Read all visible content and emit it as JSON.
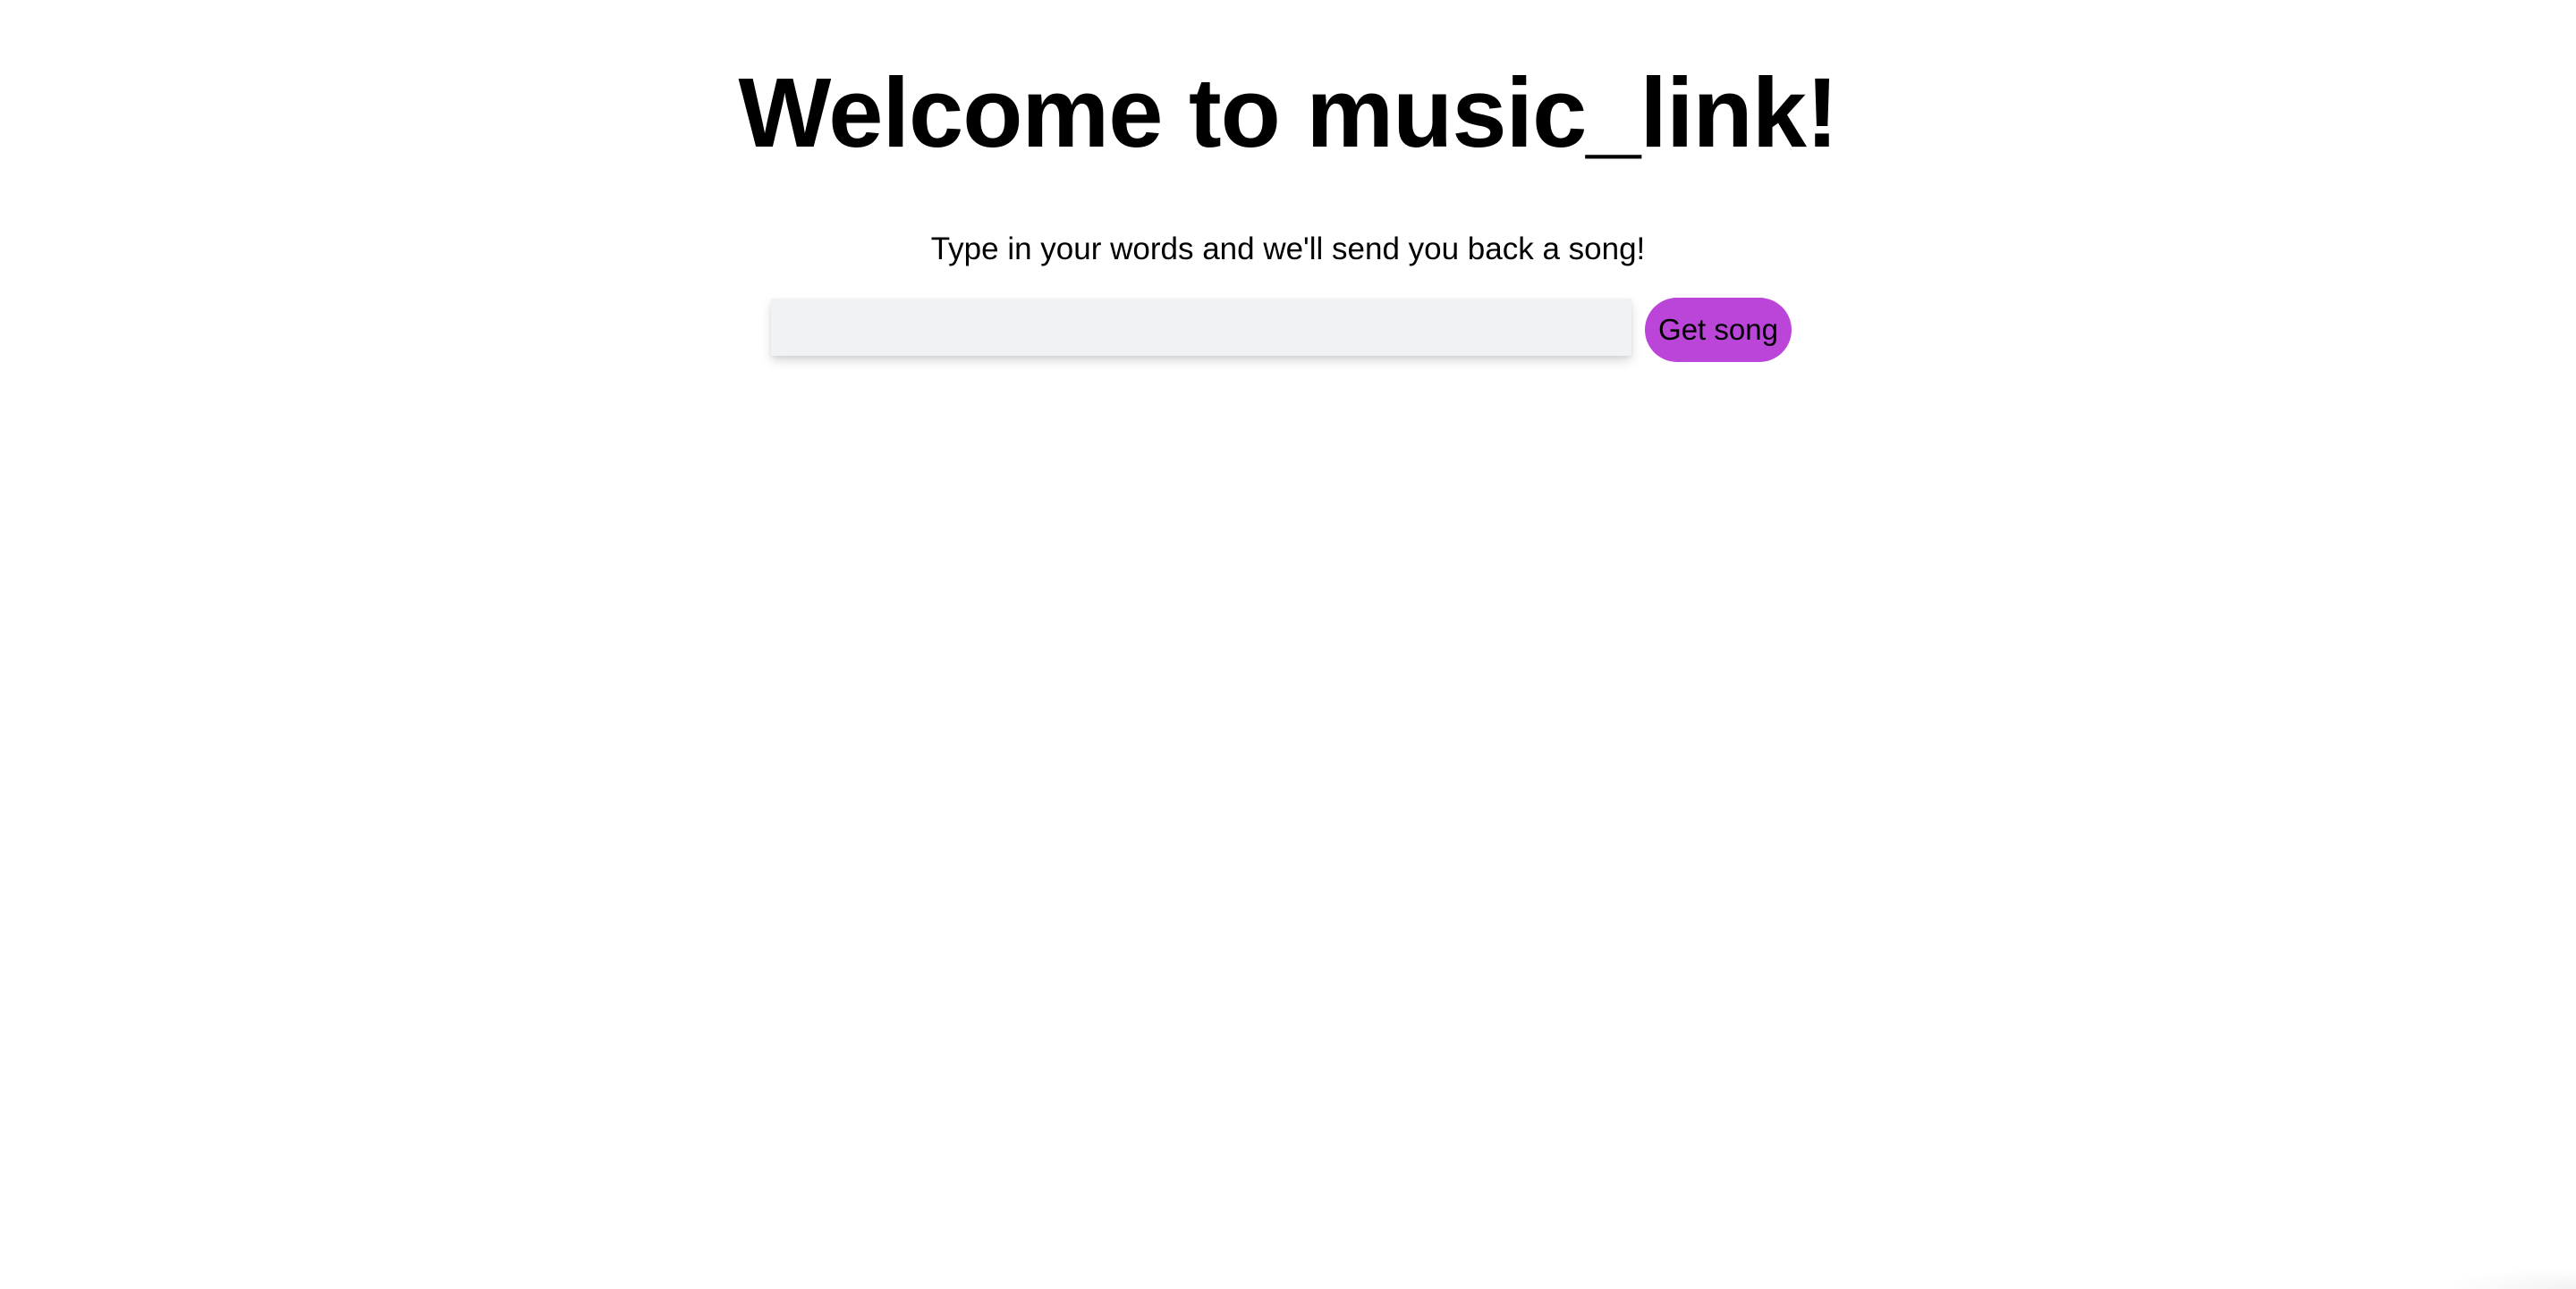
{
  "page": {
    "title": "Welcome to music_link!",
    "subtitle": "Type in your words and we'll send you back a song!"
  },
  "search": {
    "value": "",
    "placeholder": "",
    "submit_label": "Get song"
  },
  "colors": {
    "background": "#ffffff",
    "input_background": "#f1f2f4",
    "button_accent": "#bb44d9",
    "text": "#000000"
  }
}
